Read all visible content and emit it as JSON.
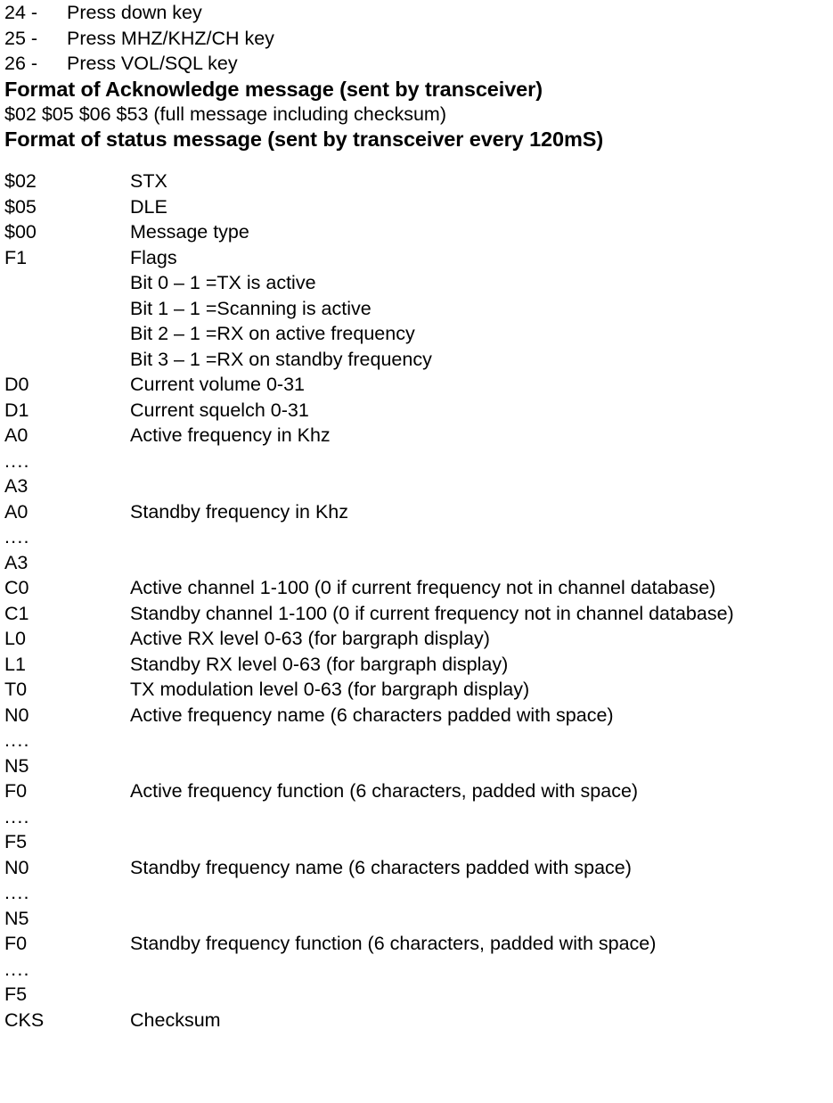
{
  "key_list": [
    {
      "num": "24 -",
      "desc": "Press down key"
    },
    {
      "num": "25 -",
      "desc": "Press MHZ/KHZ/CH key"
    },
    {
      "num": "26 -",
      "desc": "Press VOL/SQL key"
    }
  ],
  "ack_section": {
    "heading": "Format of Acknowledge message (sent by transceiver)",
    "body": "$02 $05 $06 $53 (full message including checksum)"
  },
  "status_section": {
    "heading": "Format of status message (sent by transceiver every 120mS)",
    "fields": [
      {
        "code": "$02",
        "desc": "STX"
      },
      {
        "code": "$05",
        "desc": "DLE"
      },
      {
        "code": "$00",
        "desc": "Message type"
      },
      {
        "code": "F1",
        "desc": "Flags"
      },
      {
        "code": "",
        "desc": "Bit 0 – 1 =TX is active"
      },
      {
        "code": "",
        "desc": "Bit 1 – 1 =Scanning is active"
      },
      {
        "code": "",
        "desc": "Bit 2 – 1 =RX on active frequency"
      },
      {
        "code": "",
        "desc": "Bit 3 – 1 =RX on standby frequency"
      },
      {
        "code": "D0",
        "desc": "Current volume 0-31"
      },
      {
        "code": "D1",
        "desc": "Current squelch 0-31"
      },
      {
        "code": "A0",
        "desc": "Active frequency in Khz"
      },
      {
        "code": "....",
        "desc": ""
      },
      {
        "code": "A3",
        "desc": ""
      },
      {
        "code": "A0",
        "desc": "Standby frequency in Khz"
      },
      {
        "code": "....",
        "desc": ""
      },
      {
        "code": "A3",
        "desc": ""
      },
      {
        "code": "C0",
        "desc": "Active channel 1-100 (0 if current frequency not in channel database)"
      },
      {
        "code": "C1",
        "desc": "Standby channel 1-100 (0 if current frequency not in channel database)"
      },
      {
        "code": "L0",
        "desc": "Active RX level 0-63 (for bargraph display)"
      },
      {
        "code": "L1",
        "desc": "Standby RX level 0-63 (for bargraph display)"
      },
      {
        "code": "T0",
        "desc": "TX modulation level 0-63 (for bargraph display)"
      },
      {
        "code": "N0",
        "desc": "Active frequency name (6 characters padded with space)"
      },
      {
        "code": "....",
        "desc": ""
      },
      {
        "code": "N5",
        "desc": ""
      },
      {
        "code": "F0",
        "desc": "Active frequency function (6 characters, padded with space)"
      },
      {
        "code": "....",
        "desc": ""
      },
      {
        "code": "F5",
        "desc": ""
      },
      {
        "code": "N0",
        "desc": "Standby frequency name (6 characters padded with space)"
      },
      {
        "code": "....",
        "desc": ""
      },
      {
        "code": "N5",
        "desc": ""
      },
      {
        "code": "F0",
        "desc": "Standby frequency function (6 characters, padded with space)"
      },
      {
        "code": "....",
        "desc": ""
      },
      {
        "code": "F5",
        "desc": ""
      },
      {
        "code": "CKS",
        "desc": "Checksum"
      }
    ]
  }
}
